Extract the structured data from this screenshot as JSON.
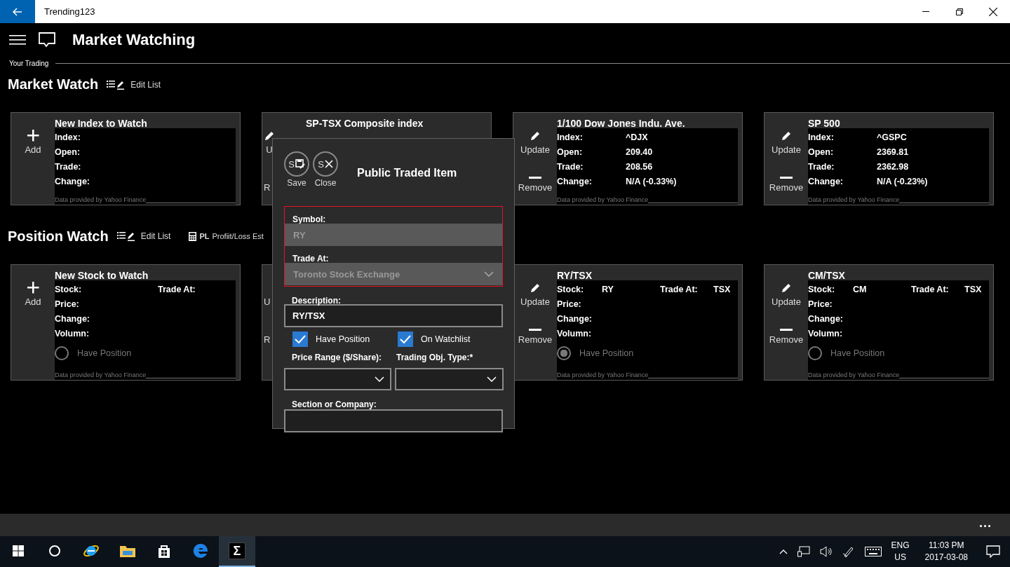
{
  "window": {
    "title": "Trending123"
  },
  "app": {
    "title": "Market Watching",
    "breadcrumb": "Your Trading"
  },
  "market_watch": {
    "title": "Market Watch",
    "edit_label": "Edit List",
    "cards": [
      {
        "kind": "new",
        "title": "New Index to Watch",
        "actions": [
          {
            "kind": "add",
            "label": "Add"
          }
        ],
        "rows": [
          {
            "label": "Index:"
          },
          {
            "label": "Open:"
          },
          {
            "label": "Trade:"
          },
          {
            "label": "Change:"
          }
        ],
        "footer": "Data provided by Yahoo Finance"
      },
      {
        "kind": "partial",
        "title": "SP-TSX Composite index",
        "actions": [
          {
            "kind": "update",
            "label": "U"
          },
          {
            "kind": "remove",
            "label": "R"
          }
        ]
      },
      {
        "kind": "item",
        "title": "1/100 Dow Jones Indu. Ave.",
        "actions": [
          {
            "kind": "update",
            "label": "Update"
          },
          {
            "kind": "remove",
            "label": "Remove"
          }
        ],
        "rows": [
          {
            "label": "Index:",
            "value": "^DJX"
          },
          {
            "label": "Open:",
            "value": "209.40"
          },
          {
            "label": "Trade:",
            "value": "208.56"
          },
          {
            "label": "Change:",
            "value": "N/A (-0.33%)"
          }
        ],
        "footer": "Data provided by Yahoo Finance"
      },
      {
        "kind": "item",
        "title": "SP 500",
        "actions": [
          {
            "kind": "update",
            "label": "Update"
          },
          {
            "kind": "remove",
            "label": "Remove"
          }
        ],
        "rows": [
          {
            "label": "Index:",
            "value": "^GSPC"
          },
          {
            "label": "Open:",
            "value": "2369.81"
          },
          {
            "label": "Trade:",
            "value": "2362.98"
          },
          {
            "label": "Change:",
            "value": "N/A (-0.23%)"
          }
        ],
        "footer": "Data provided by Yahoo Finance"
      }
    ]
  },
  "position_watch": {
    "title": "Position Watch",
    "edit_label": "Edit List",
    "pl_glyph": "PL",
    "pl_label": "Profiit/Loss Est",
    "cards": [
      {
        "kind": "new",
        "title": "New Stock to Watch",
        "actions": [
          {
            "kind": "add",
            "label": "Add"
          }
        ],
        "stock_label": "Stock:",
        "trade_label": "Trade At:",
        "rows": [
          {
            "label": "Price:"
          },
          {
            "label": "Change:"
          },
          {
            "label": "Volumn:"
          }
        ],
        "have_position": {
          "label": "Have Position",
          "checked": false
        },
        "footer": "Data provided by Yahoo Finance"
      },
      {
        "kind": "partial",
        "actions": [
          {
            "kind": "update",
            "label": "U"
          },
          {
            "kind": "remove",
            "label": "R"
          }
        ]
      },
      {
        "kind": "item",
        "title": "RY/TSX",
        "actions": [
          {
            "kind": "update",
            "label": "Update"
          },
          {
            "kind": "remove",
            "label": "Remove"
          }
        ],
        "stock_label": "Stock:",
        "stock": "RY",
        "trade_label": "Trade At:",
        "trade_at": "TSX",
        "rows": [
          {
            "label": "Price:"
          },
          {
            "label": "Change:"
          },
          {
            "label": "Volumn:"
          }
        ],
        "have_position": {
          "label": "Have Position",
          "checked": true
        },
        "footer": "Data provided by Yahoo Finance"
      },
      {
        "kind": "item",
        "title": "CM/TSX",
        "actions": [
          {
            "kind": "update",
            "label": "Update"
          },
          {
            "kind": "remove",
            "label": "Remove"
          }
        ],
        "stock_label": "Stock:",
        "stock": "CM",
        "trade_label": "Trade At:",
        "trade_at": "TSX",
        "rows": [
          {
            "label": "Price:"
          },
          {
            "label": "Change:"
          },
          {
            "label": "Volumn:"
          }
        ],
        "have_position": {
          "label": "Have Position",
          "checked": false
        },
        "footer": "Data provided by Yahoo Finance"
      }
    ]
  },
  "dialog": {
    "title": "Public Traded Item",
    "buttons": [
      {
        "kind": "save",
        "glyph": "S",
        "label": "Save"
      },
      {
        "kind": "close",
        "glyph": "S",
        "label": "Close"
      }
    ],
    "invalid": true,
    "symbol": {
      "label": "Symbol:",
      "value": "RY",
      "disabled": true
    },
    "trade_at": {
      "label": "Trade At:",
      "value": "Toronto Stock Exchange",
      "disabled": true
    },
    "description": {
      "label": "Description:",
      "value": "RY/TSX"
    },
    "checkboxes": [
      {
        "label": "Have Position",
        "checked": true
      },
      {
        "label": "On Watchlist",
        "checked": true
      }
    ],
    "price_range": {
      "label": "Price Range ($/Share):"
    },
    "trading_type": {
      "label": "Trading Obj. Type:*"
    },
    "section": {
      "label": "Section or Company:"
    }
  },
  "app_bar": {
    "more": "..."
  },
  "taskbar": {
    "apps": [
      {
        "kind": "start",
        "selected": false
      },
      {
        "kind": "search",
        "selected": false
      },
      {
        "kind": "ie",
        "selected": false
      },
      {
        "kind": "folder",
        "selected": false
      },
      {
        "kind": "store",
        "selected": false
      },
      {
        "kind": "edge",
        "selected": false
      },
      {
        "kind": "sigma",
        "glyph": "Σ",
        "selected": true
      }
    ],
    "language": "ENG",
    "region": "US",
    "time": "11:03 PM",
    "date": "2017-03-08"
  }
}
